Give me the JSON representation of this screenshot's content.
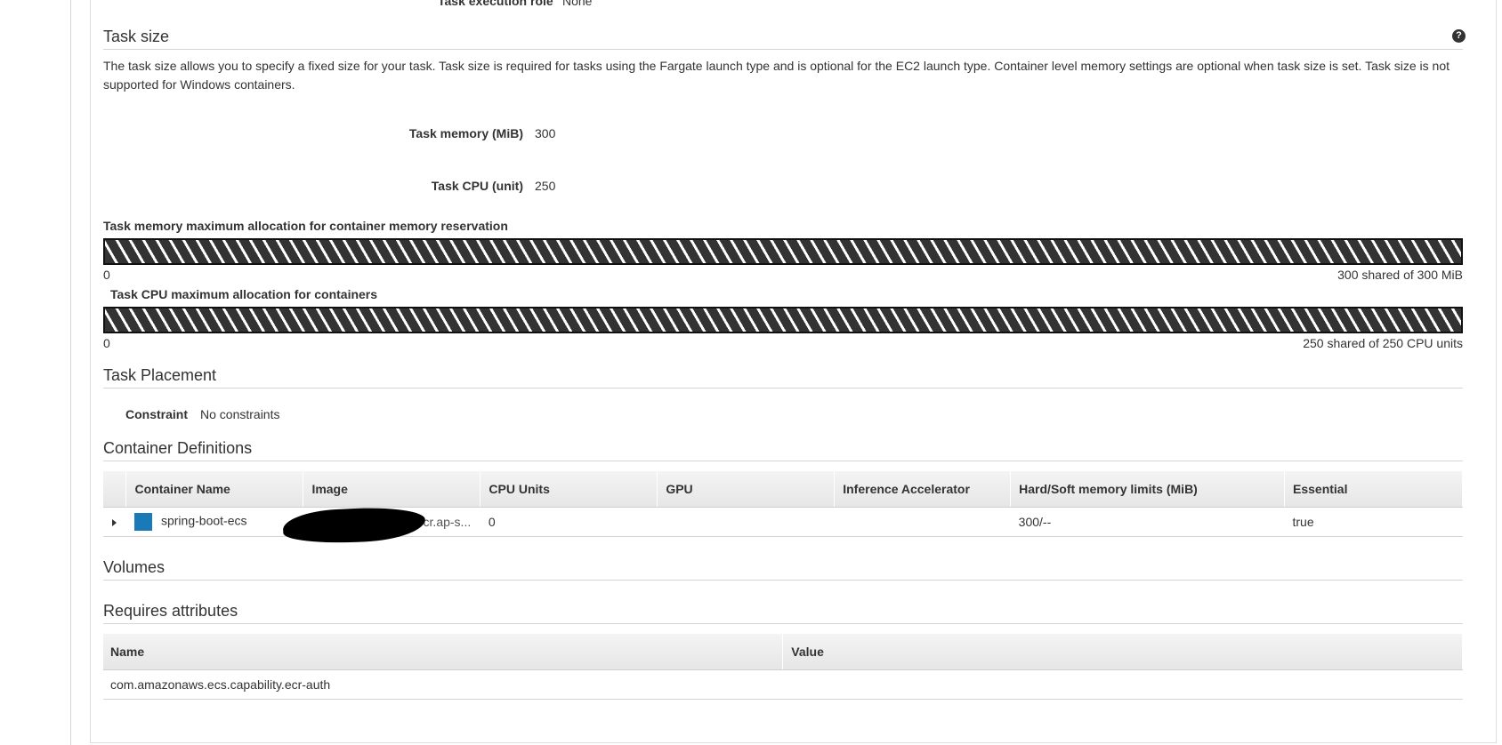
{
  "header_cutoff": {
    "label": "Task execution role",
    "value": "None"
  },
  "task_size": {
    "title": "Task size",
    "description": "The task size allows you to specify a fixed size for your task. Task size is required for tasks using the Fargate launch type and is optional for the EC2 launch type. Container level memory settings are optional when task size is set. Task size is not supported for Windows containers.",
    "help_icon": "question-circle-icon",
    "memory_label": "Task memory (MiB)",
    "memory_value": "300",
    "cpu_label": "Task CPU (unit)",
    "cpu_value": "250"
  },
  "memory_allocation": {
    "title": "Task memory maximum allocation for container memory reservation",
    "min_label": "0",
    "max_label": "300 shared of 300 MiB",
    "fill_fraction": 1.0
  },
  "cpu_allocation": {
    "title": "Task CPU maximum allocation for containers",
    "min_label": "0",
    "max_label": "250 shared of 250 CPU units",
    "fill_fraction": 1.0
  },
  "task_placement": {
    "title": "Task Placement",
    "constraint_label": "Constraint",
    "constraint_value": "No constraints"
  },
  "container_definitions": {
    "title": "Container Definitions",
    "columns": [
      "Container Name",
      "Image",
      "CPU Units",
      "GPU",
      "Inference Accelerator",
      "Hard/Soft memory limits (MiB)",
      "Essential"
    ],
    "rows": [
      {
        "name": "spring-boot-ecs",
        "image": "778111280690.dkr.ecr.ap-s...",
        "cpu_units": "0",
        "gpu": "",
        "inference_accelerator": "",
        "memory_limits": "300/--",
        "essential": "true",
        "color": "#1a7ab8"
      }
    ]
  },
  "volumes": {
    "title": "Volumes"
  },
  "requires_attributes": {
    "title": "Requires attributes",
    "columns": [
      "Name",
      "Value"
    ],
    "rows": [
      {
        "name": "com.amazonaws.ecs.capability.ecr-auth",
        "value": ""
      }
    ]
  }
}
